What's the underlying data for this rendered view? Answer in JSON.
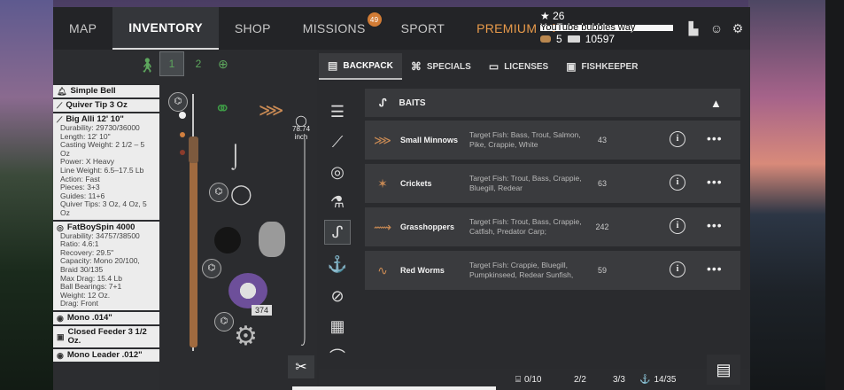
{
  "nav": {
    "tabs": [
      {
        "label": "MAP"
      },
      {
        "label": "INVENTORY"
      },
      {
        "label": "SHOP"
      },
      {
        "label": "MISSIONS",
        "badge": "49"
      },
      {
        "label": "SPORT"
      },
      {
        "label": "PREMIUM"
      }
    ]
  },
  "player": {
    "stars": "26",
    "channel": "YouTube bubbles way",
    "baitcoins": "5",
    "money": "10597"
  },
  "slots": [
    "1",
    "2"
  ],
  "tackle": {
    "items": [
      {
        "name": "Simple Bell",
        "stats": []
      },
      {
        "name": "Quiver Tip 3 Oz",
        "stats": []
      },
      {
        "name": "Big Alli 12' 10\"",
        "stats": [
          "Durability: 29730/36000",
          "Length: 12' 10\"",
          "Casting Weight: 2 1/2 – 5 Oz",
          "Power: X Heavy",
          "Line Weight: 6.5–17.5 Lb",
          "Action: Fast",
          "Pieces: 3+3",
          "Guides: 11+6",
          "Quiver Tips: 3 Oz, 4 Oz, 5 Oz"
        ]
      },
      {
        "name": "FatBoySpin 4000",
        "stats": [
          "Durability: 34757/38500",
          "Ratio: 4.6:1",
          "Recovery: 29.5\"",
          "Capacity: Mono 20/100, Braid 30/135",
          "Max Drag: 15.4 Lb",
          "Ball Bearings: 7+1",
          "Weight: 12 Oz.",
          "Drag: Front"
        ]
      },
      {
        "name": "Mono .014\"",
        "stats": []
      },
      {
        "name": "Closed Feeder 3 1/2 Oz.",
        "stats": []
      },
      {
        "name": "Mono Leader .012\"",
        "stats": []
      }
    ]
  },
  "rig": {
    "leader_length": "78.74",
    "leader_unit": "inch",
    "line_count": "374"
  },
  "subtabs": [
    {
      "label": "BACKPACK"
    },
    {
      "label": "SPECIALS"
    },
    {
      "label": "LICENSES"
    },
    {
      "label": "FISHKEEPER"
    }
  ],
  "category": {
    "title": "BAITS"
  },
  "baits": [
    {
      "name": "Small Minnows",
      "target": "Target Fish: Bass, Trout, Salmon, Pike, Crappie, White",
      "count": "43"
    },
    {
      "name": "Crickets",
      "target": "Target Fish: Trout, Bass, Crappie, Bluegill, Redear",
      "count": "63"
    },
    {
      "name": "Grasshoppers",
      "target": "Target Fish: Trout, Bass, Crappie, Catfish, Predator Carp;",
      "count": "242"
    },
    {
      "name": "Red Worms",
      "target": "Target Fish: Crappie, Bluegill, Pumpkinseed, Redear Sunfish,",
      "count": "59"
    }
  ],
  "footer": {
    "backpack": "0/10",
    "rods": "2/2",
    "reels": "3/3",
    "hooks": "14/35"
  },
  "colors": {
    "premium": "#e89a4a",
    "badge": "#d27c35",
    "accent": "#5da65d"
  }
}
